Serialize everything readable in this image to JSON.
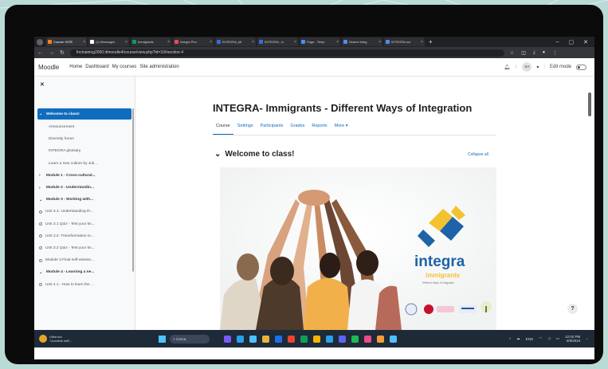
{
  "browser": {
    "tabs": [
      {
        "label": "Course: INTE",
        "color": "#f98012",
        "active": true
      },
      {
        "label": "(1) Messages",
        "color": "#ffffff",
        "active": false
      },
      {
        "label": "Immigrants",
        "color": "#0b9e5a",
        "active": false
      },
      {
        "label": "Integra Pho",
        "color": "#ea4c4c",
        "active": false
      },
      {
        "label": "INTEGRA_kit",
        "color": "#2f6ee6",
        "active": false
      },
      {
        "label": "INTEGRA - Ic",
        "color": "#2f6ee6",
        "active": false
      },
      {
        "label": "Page - Temp",
        "color": "#4b8df8",
        "active": false
      },
      {
        "label": "Search integ",
        "color": "#4b8df8",
        "active": false
      },
      {
        "label": "INTEGRA-wo",
        "color": "#4b8df8",
        "active": false
      }
    ],
    "url": "fnctraining2000.it/moodle4/course/view.php?id=10#section-4"
  },
  "moodle": {
    "brand": "Moodle",
    "nav": [
      "Home",
      "Dashboard",
      "My courses",
      "Site administration"
    ],
    "user_initials": "SA",
    "edit_mode_label": "Edit mode"
  },
  "drawer": {
    "items": [
      {
        "label": "Welcome to class!",
        "kind": "active",
        "chevron": "⌄"
      },
      {
        "label": "Announcement",
        "kind": "sub"
      },
      {
        "label": "Diversity forum",
        "kind": "sub"
      },
      {
        "label": "INTEGRA glossary",
        "kind": "sub"
      },
      {
        "label": "Learn a new culture by Juli...",
        "kind": "sub"
      },
      {
        "label": "Module 1 - Cross-cultural...",
        "kind": "mod",
        "chevron": "›"
      },
      {
        "label": "Module 2 - Understandin...",
        "kind": "mod",
        "chevron": "›"
      },
      {
        "label": "Module 3 - Working with...",
        "kind": "mod",
        "chevron": "⌄"
      },
      {
        "label": "Unit 3.1- Understanding th...",
        "kind": "unit"
      },
      {
        "label": "Unit 3.1 Quiz - Test your kn...",
        "kind": "unit"
      },
      {
        "label": "Unit 3.2- Transformation to...",
        "kind": "unit"
      },
      {
        "label": "Unit 3.2 Quiz - Test your kn...",
        "kind": "unit"
      },
      {
        "label": "Module 3 Final self-assess...",
        "kind": "unit"
      },
      {
        "label": "Module 4 - Learning a ne...",
        "kind": "mod",
        "chevron": "⌄"
      },
      {
        "label": "Unit 4.1 - How to learn the ...",
        "kind": "unit"
      }
    ]
  },
  "course": {
    "title": "INTEGRA- Immigrants - Different Ways of Integration",
    "tabs": [
      "Course",
      "Settings",
      "Participants",
      "Grades",
      "Reports",
      "More ▾"
    ],
    "section_title": "Welcome to class!",
    "collapse_all": "Collapse all",
    "logo_word": "integra",
    "logo_sub": "immigrants",
    "logo_tagline": "Different Ways of Integration"
  },
  "taskbar": {
    "weather_line1": "Ultim'ora",
    "weather_line2": "\"Uccidete tutti\"...",
    "search_placeholder": "Cerca",
    "app_colors": [
      "#7a5af8",
      "#2aa0e8",
      "#4cc2ff",
      "#e8b23a",
      "#1f6feb",
      "#ea4335",
      "#0f9d58",
      "#f4b400",
      "#2aa0e8",
      "#5865f2",
      "#1db954",
      "#ea4c89",
      "#f29d38",
      "#4cc2ff"
    ],
    "time": "12:02 PM",
    "date": "4/9/2024"
  },
  "colors": {
    "accent": "#0f6cbf",
    "logo_blue": "#1e63a8",
    "logo_yellow": "#f2c230"
  }
}
